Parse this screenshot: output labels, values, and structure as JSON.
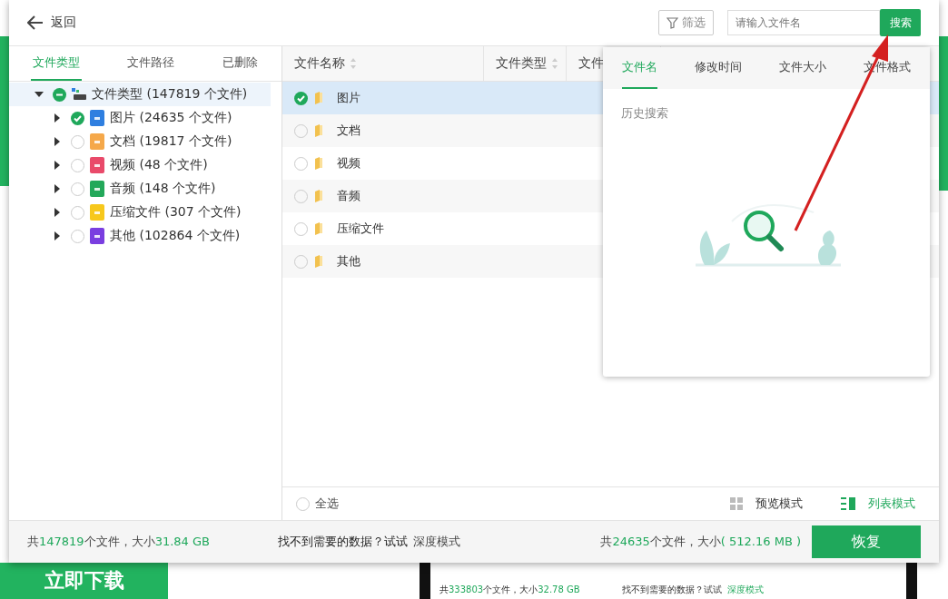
{
  "background": {
    "download_button": "立即下载",
    "thumbnail": {
      "total": [
        {
          "text": "共",
          "highlight": false
        },
        {
          "text": "333803",
          "highlight": true
        },
        {
          "text": "个文件，大小",
          "highlight": false
        },
        {
          "text": "32.78 GB",
          "highlight": true
        }
      ],
      "hint": "找不到需要的数据？试试",
      "link": "深度模式"
    }
  },
  "header": {
    "back_label": "返回",
    "filter_button": "筛选",
    "search": {
      "placeholder": "请输入文件名",
      "button": "搜索"
    }
  },
  "left_tabs": [
    {
      "label": "文件类型",
      "selected": true
    },
    {
      "label": "文件路径",
      "selected": false
    },
    {
      "label": "已删除",
      "selected": false
    }
  ],
  "tree": {
    "label": "文件类型 (147819 个文件)",
    "expanded": true,
    "partial": true,
    "children": [
      {
        "label": "图片 (24635 个文件)",
        "color": "#2f7fe0",
        "checked": true,
        "expanded": false
      },
      {
        "label": "文档 (19817 个文件)",
        "color": "#f5a84a",
        "checked": false,
        "expanded": false
      },
      {
        "label": "视频 (48 个文件)",
        "color": "#e94a6a",
        "checked": false,
        "expanded": false
      },
      {
        "label": "音频 (148 个文件)",
        "color": "#23a85a",
        "checked": false,
        "expanded": false
      },
      {
        "label": "压缩文件 (307 个文件)",
        "color": "#f7c81c",
        "checked": false,
        "expanded": false
      },
      {
        "label": "其他 (102864 个文件)",
        "color": "#7a3ee0",
        "checked": false,
        "expanded": false
      }
    ]
  },
  "table": {
    "columns": [
      "文件名称",
      "文件类型",
      "文件"
    ],
    "rows": [
      {
        "name": "图片",
        "selected": true,
        "checked": true
      },
      {
        "name": "文档",
        "selected": false,
        "checked": false
      },
      {
        "name": "视频",
        "selected": false,
        "checked": false
      },
      {
        "name": "音频",
        "selected": false,
        "checked": false
      },
      {
        "name": "压缩文件",
        "selected": false,
        "checked": false
      },
      {
        "name": "其他",
        "selected": false,
        "checked": false
      }
    ]
  },
  "table_footer": {
    "select_all": {
      "label": "全选",
      "checked": false
    },
    "view_modes": [
      {
        "label": "预览模式",
        "kind": "grid",
        "selected": false
      },
      {
        "label": "列表模式",
        "kind": "list",
        "selected": true
      }
    ]
  },
  "status": {
    "total": [
      {
        "text": "共",
        "highlight": false
      },
      {
        "text": "147819",
        "highlight": true
      },
      {
        "text": "个文件，大小",
        "highlight": false
      },
      {
        "text": "31.84 GB",
        "highlight": true
      }
    ],
    "hint": "找不到需要的数据？试试",
    "link": "深度模式",
    "selection": [
      {
        "text": "共",
        "highlight": false
      },
      {
        "text": "24635",
        "highlight": true
      },
      {
        "text": "个文件，大小",
        "highlight": false
      },
      {
        "text": "( 512.16 MB )",
        "highlight": true
      }
    ],
    "restore_button": "恢复"
  },
  "search_popup": {
    "tabs": [
      {
        "label": "文件名",
        "selected": true
      },
      {
        "label": "修改时间",
        "selected": false
      },
      {
        "label": "文件大小",
        "selected": false
      },
      {
        "label": "文件格式",
        "selected": false
      }
    ],
    "history_label": "历史搜索"
  }
}
